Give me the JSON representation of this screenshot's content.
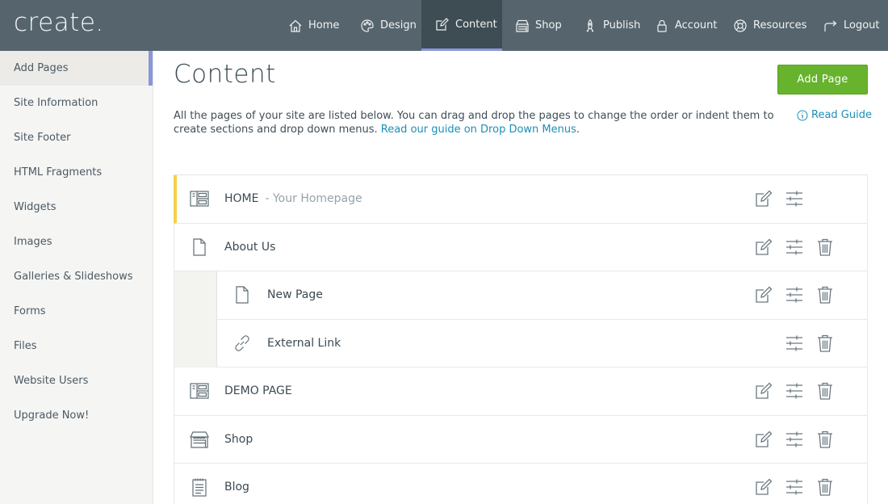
{
  "app": {
    "logo": "create."
  },
  "nav": [
    {
      "label": "Home",
      "icon": "home-icon"
    },
    {
      "label": "Design",
      "icon": "palette-icon"
    },
    {
      "label": "Content",
      "icon": "edit-icon",
      "active": true
    },
    {
      "label": "Shop",
      "icon": "shop-icon"
    },
    {
      "label": "Publish",
      "icon": "rocket-icon"
    },
    {
      "label": "Account",
      "icon": "lock-icon"
    },
    {
      "label": "Resources",
      "icon": "lifebuoy-icon"
    },
    {
      "label": "Logout",
      "icon": "logout-icon"
    }
  ],
  "sidebar": {
    "items": [
      {
        "label": "Add Pages",
        "active": true
      },
      {
        "label": "Site Information"
      },
      {
        "label": "Site Footer"
      },
      {
        "label": "HTML Fragments"
      },
      {
        "label": "Widgets"
      },
      {
        "label": "Images"
      },
      {
        "label": "Galleries & Slideshows"
      },
      {
        "label": "Forms"
      },
      {
        "label": "Files"
      },
      {
        "label": "Website Users"
      },
      {
        "label": "Upgrade Now!"
      }
    ]
  },
  "main": {
    "title": "Content",
    "add_page_label": "Add Page",
    "intro_text": "All the pages of your site are listed below. You can drag and drop the pages to change the order or indent them to create sections and drop down menus.",
    "intro_link": "Read our guide on Drop Down Menus",
    "intro_end": ".",
    "read_guide": "Read Guide"
  },
  "pages": [
    {
      "label": "HOME",
      "sub": "- Your Homepage",
      "icon": "layout-icon",
      "edit": true,
      "settings": true,
      "trash": false
    },
    {
      "label": "About Us",
      "icon": "page-icon",
      "edit": true,
      "settings": true,
      "trash": true
    },
    {
      "label": "New Page",
      "icon": "page-icon",
      "child": true,
      "edit": true,
      "settings": true,
      "trash": true
    },
    {
      "label": "External Link",
      "icon": "link-icon",
      "child": true,
      "edit": false,
      "settings": true,
      "trash": true
    },
    {
      "label": "DEMO PAGE",
      "icon": "layout-icon",
      "edit": true,
      "settings": true,
      "trash": true
    },
    {
      "label": "Shop",
      "icon": "shop-icon",
      "edit": true,
      "settings": true,
      "trash": true
    },
    {
      "label": "Blog",
      "icon": "blog-icon",
      "edit": true,
      "settings": true,
      "trash": true
    }
  ],
  "colors": {
    "topbar": "#56656d",
    "accent": "#8a96d8",
    "button": "#67b32d",
    "link": "#1c8fb6",
    "home_marker": "#f5d04a"
  }
}
